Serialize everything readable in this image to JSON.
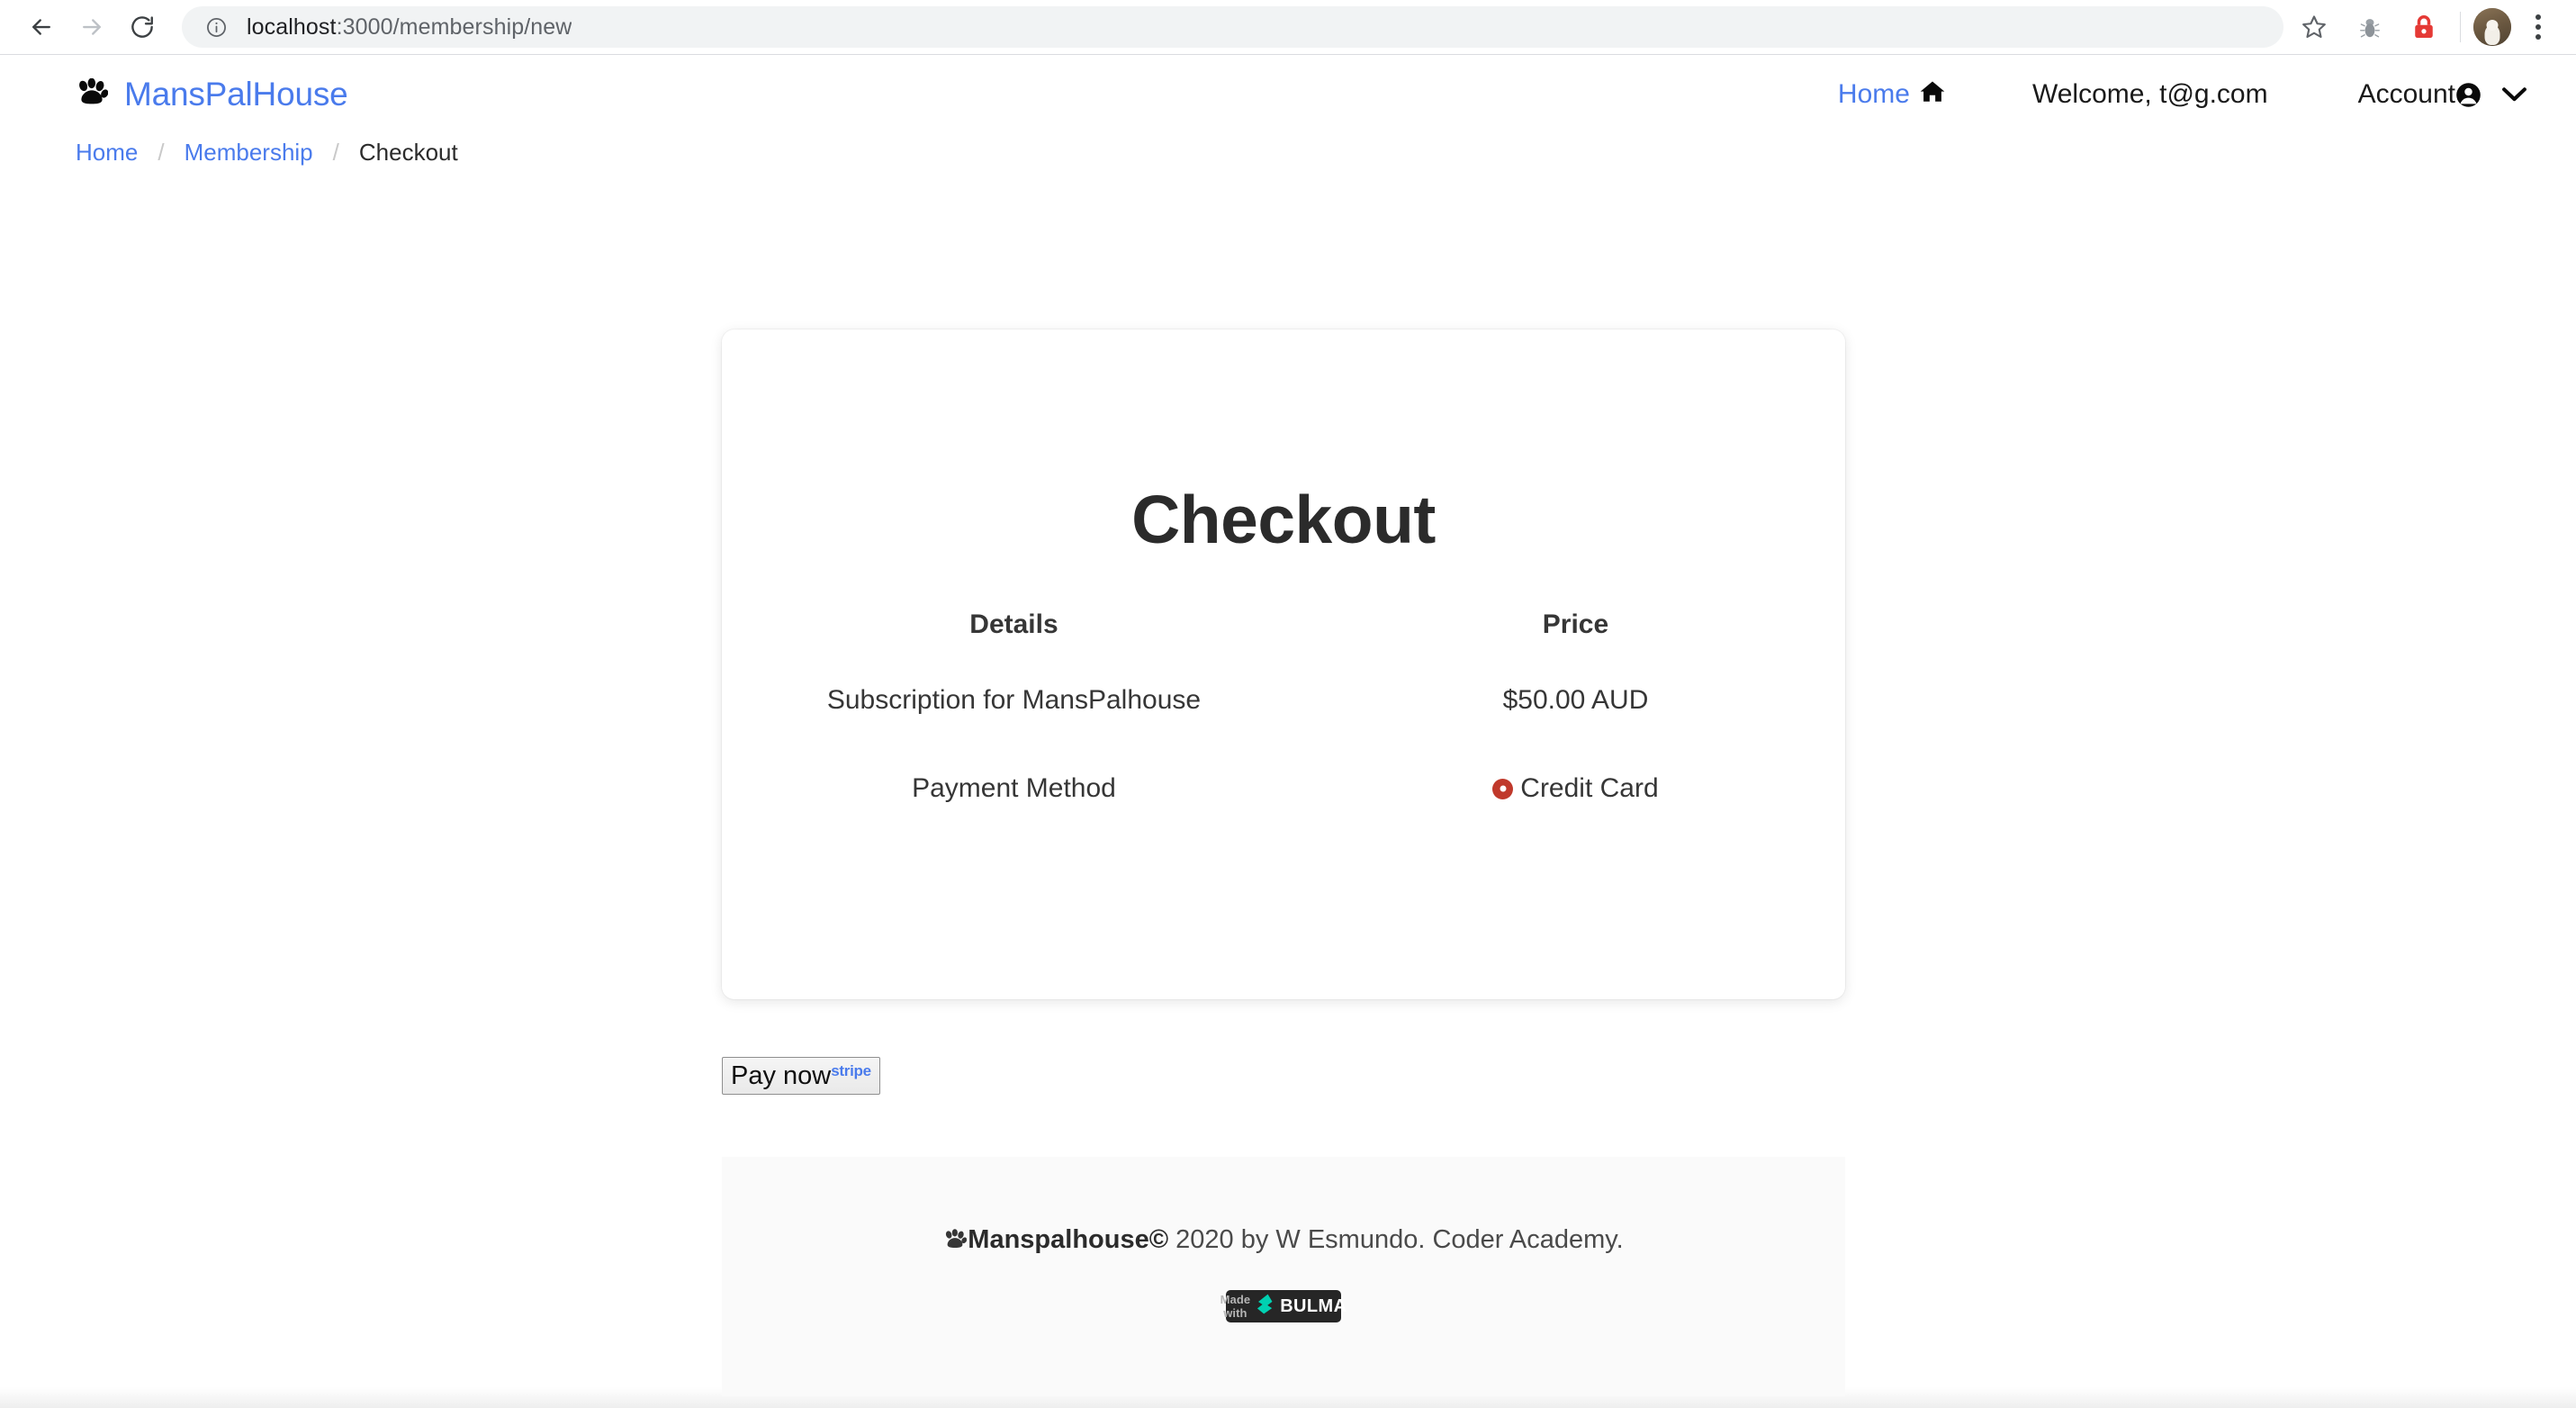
{
  "browser": {
    "back_label": "Back",
    "forward_label": "Forward",
    "reload_label": "Reload",
    "url_host": "localhost",
    "url_path": ":3000/membership/new",
    "url_full": "localhost:3000/membership/new",
    "site_info_icon": "info-circle-icon",
    "bookmark_icon": "star-icon",
    "extensions": [
      {
        "name": "bug-extension-icon",
        "color": "#9aa0a6"
      },
      {
        "name": "lock-extension-icon",
        "color": "#e53935"
      }
    ],
    "profile_label": "Profile",
    "menu_label": "Customize and control Chrome"
  },
  "navbar": {
    "brand": "MansPalHouse",
    "brand_icon": "paw-icon",
    "brand_color": "#4a7bec",
    "home_label": "Home",
    "home_icon": "home-icon",
    "welcome_text": "Welcome, t@g.com",
    "account_label": "Account",
    "account_icon": "user-circle-icon",
    "account_chevron": "chevron-down-icon"
  },
  "breadcrumb": {
    "items": [
      {
        "label": "Home",
        "current": false
      },
      {
        "label": "Membership",
        "current": false
      },
      {
        "label": "Checkout",
        "current": true
      }
    ],
    "separator": "/"
  },
  "checkout": {
    "title": "Checkout",
    "columns": {
      "details": "Details",
      "price": "Price"
    },
    "rows": [
      {
        "details": "Subscription for MansPalhouse",
        "price": "$50.00 AUD"
      }
    ],
    "payment": {
      "label": "Payment Method",
      "selected_option": "Credit Card",
      "radio_color": "#c0392b",
      "radio_icon": "radio-selected-icon"
    }
  },
  "pay": {
    "button_label": "Pay now",
    "stripe_mark": "stripe",
    "stripe_color": "#4a7bec"
  },
  "footer": {
    "paw_icon": "paw-icon",
    "brand": "Manspalhouse©",
    "credit": " 2020 by W Esmundo. Coder Academy.",
    "badge": {
      "made_with": "Made with",
      "product": "BULMA",
      "logo_icon": "bulma-logo-icon",
      "logo_color": "#00d1b2",
      "background": "#262626"
    }
  }
}
